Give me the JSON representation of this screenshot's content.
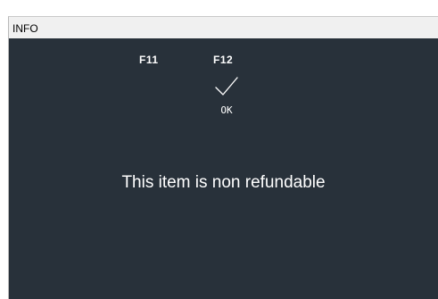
{
  "window": {
    "title": "INFO"
  },
  "fkeys": {
    "f11": "F11",
    "f12": "F12"
  },
  "ok_button": {
    "label": "OK",
    "icon": "checkmark-icon"
  },
  "message": {
    "text": "This item is non refundable"
  },
  "colors": {
    "panel_background": "#28313a",
    "text": "#ffffff",
    "titlebar": "#f0f0f0"
  }
}
